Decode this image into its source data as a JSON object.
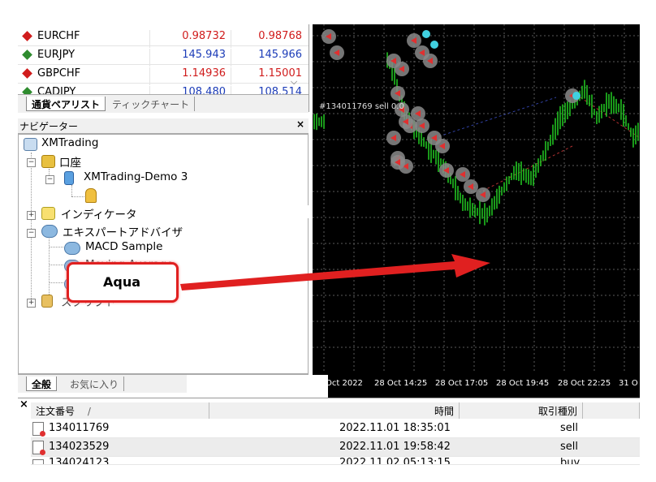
{
  "market_watch": {
    "rows": [
      {
        "symbol": "EURCHF",
        "bid": "0.98732",
        "ask": "0.98768",
        "color": "#d01c1c",
        "arrow_color": "#d01c1c"
      },
      {
        "symbol": "EURJPY",
        "bid": "145.943",
        "ask": "145.966",
        "color": "#1c3cb8",
        "arrow_color": "#2e8b2e"
      },
      {
        "symbol": "GBPCHF",
        "bid": "1.14936",
        "ask": "1.15001",
        "color": "#d01c1c",
        "arrow_color": "#d01c1c"
      },
      {
        "symbol": "CADJPY",
        "bid": "108.480",
        "ask": "108.514",
        "color": "#1c3cb8",
        "arrow_color": "#2e8b2e"
      }
    ],
    "tabs": [
      "通貨ペアリスト",
      "ティックチャート"
    ]
  },
  "navigator": {
    "title": "ナビゲーター",
    "close": "×",
    "root": "XMTrading",
    "accounts_label": "口座",
    "account_name": "XMTrading-Demo 3",
    "indicators_label": "インディケータ",
    "experts_label": "エキスパートアドバイザ",
    "expert_1": "MACD Sample",
    "expert_2": "Moving Average",
    "scripts_label": "スクリプト",
    "tabs": [
      "全般",
      "お気に入り"
    ]
  },
  "callout": {
    "label": "Aqua",
    "box_color": "#e02020",
    "arrow_color": "#e02020"
  },
  "chart": {
    "order_label": "#134011769 sell 0.0",
    "time_labels": [
      "Oct 2022",
      "28 Oct 14:25",
      "28 Oct 17:05",
      "28 Oct 19:45",
      "28 Oct 22:25",
      "31 O"
    ],
    "background": "#000000",
    "candle_color": "#22cc22"
  },
  "terminal": {
    "close": "×",
    "headers": {
      "order": "注文番号",
      "sort": "/",
      "time": "時間",
      "type": "取引種別"
    },
    "rows": [
      {
        "order": "134011769",
        "time": "2022.11.01 18:35:01",
        "type": "sell"
      },
      {
        "order": "134023529",
        "time": "2022.11.01 19:58:42",
        "type": "sell"
      },
      {
        "order": "134024123",
        "time": "2022.11.02 05:13:15",
        "type": "buy"
      }
    ]
  }
}
